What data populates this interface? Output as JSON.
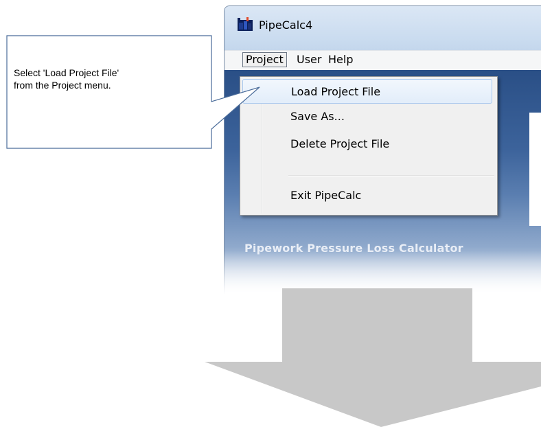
{
  "window": {
    "title": "PipeCalc4",
    "subtitle": "Pipework Pressure Loss Calculator"
  },
  "menubar": {
    "items": [
      {
        "label": "Project"
      },
      {
        "label": "User"
      },
      {
        "label": "Help"
      }
    ]
  },
  "project_menu": {
    "items": [
      {
        "label": "Load Project File",
        "highlighted": true
      },
      {
        "label": "Save As..."
      },
      {
        "label": "Delete Project File"
      },
      {
        "label": "Exit PipeCalc"
      }
    ]
  },
  "callout": {
    "line1": "Select 'Load Project File'",
    "line2": "from the Project menu."
  },
  "colors": {
    "accent_blue": "#2a4f86",
    "menu_highlight_border": "#a8c7ed",
    "arrow_fill": "#c8c8c8",
    "callout_border": "#4a6c9a"
  }
}
